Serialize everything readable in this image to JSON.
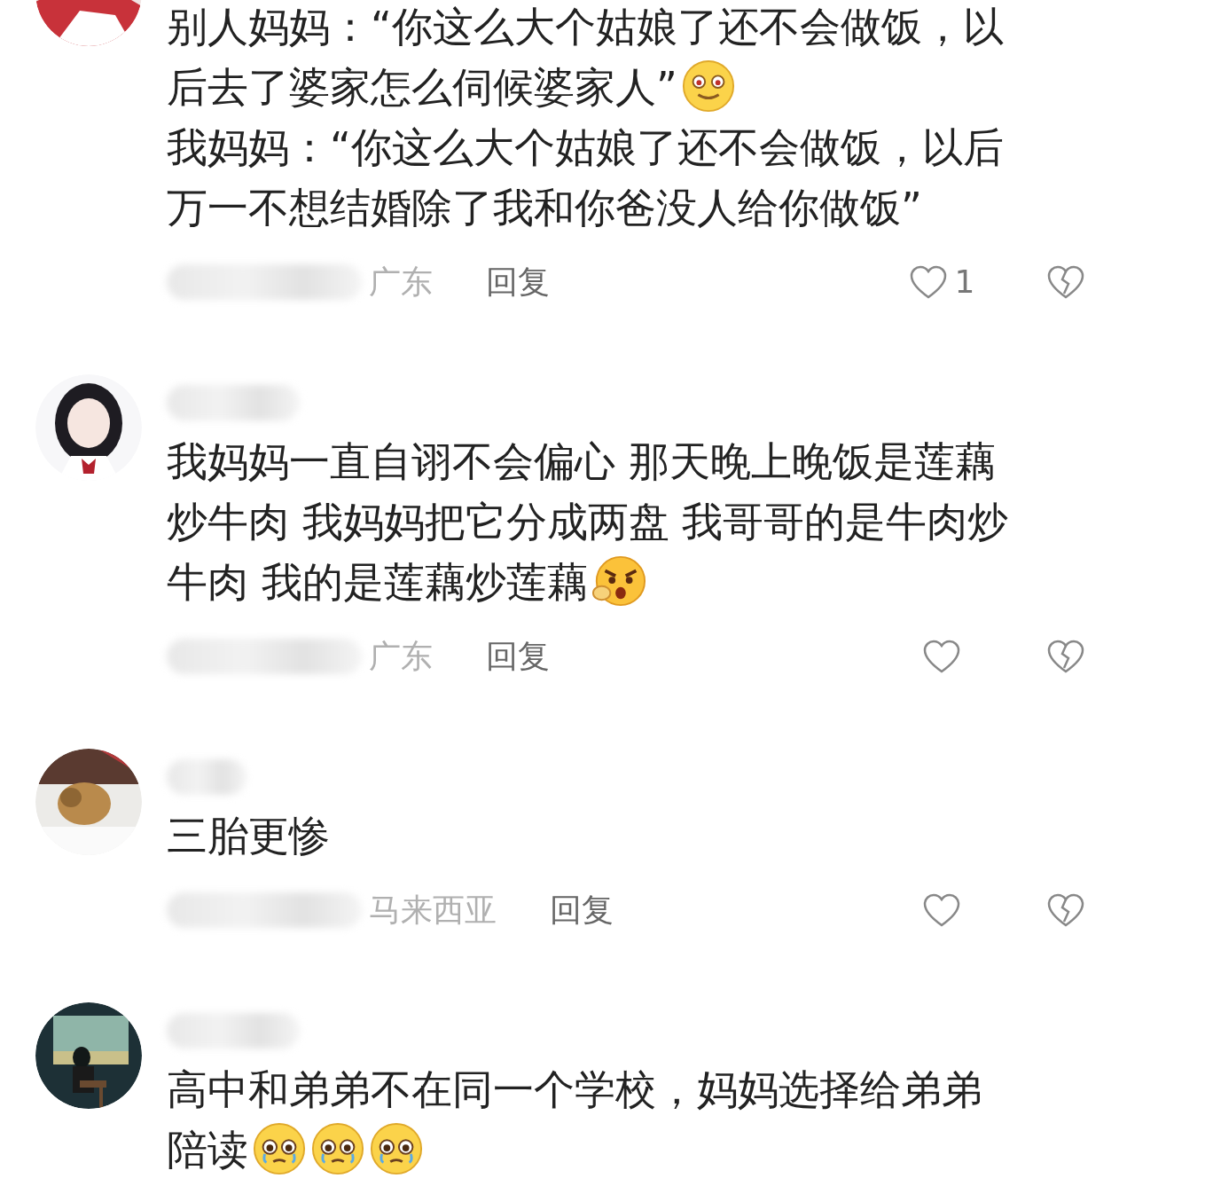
{
  "comments": [
    {
      "avatar": {
        "kind": "picture"
      },
      "lines": [
        [
          {
            "kind": "text",
            "text": "别人妈妈：“你这么大个姑娘了还不会做饭，以"
          }
        ],
        [
          {
            "kind": "text",
            "text": "后去了婆家怎么伺候婆家人”"
          },
          {
            "kind": "blush"
          }
        ],
        [
          {
            "kind": "text",
            "text": "我妈妈：“你这么大个姑娘了还不会做饭，以后"
          }
        ],
        [
          {
            "kind": "text",
            "text": "万一不想结婚除了我和你爸没人给你做饭”"
          }
        ]
      ],
      "location": "广东",
      "reply": "回复",
      "likes": "1"
    },
    {
      "avatar": {
        "kind": "picture"
      },
      "lines": [
        [
          {
            "kind": "text",
            "text": "我妈妈一直自诩不会偏心 那天晚上晚饭是莲藕"
          }
        ],
        [
          {
            "kind": "text",
            "text": "炒牛肉 我妈妈把它分成两盘 我哥哥的是牛肉炒"
          }
        ],
        [
          {
            "kind": "text",
            "text": "牛肉 我的是莲藕炒莲藕"
          },
          {
            "kind": "angry"
          }
        ]
      ],
      "location": "广东",
      "reply": "回复"
    },
    {
      "avatar": {
        "kind": "picture"
      },
      "lines": [
        [
          {
            "kind": "text",
            "text": "三胎更惨"
          }
        ]
      ],
      "location": "马来西亚",
      "reply": "回复"
    },
    {
      "avatar": {
        "kind": "picture"
      },
      "lines": [
        [
          {
            "kind": "text",
            "text": "高中和弟弟不在同一个学校，妈妈选择给弟弟"
          }
        ],
        [
          {
            "kind": "text",
            "text": "陪读"
          },
          {
            "kind": "teary"
          },
          {
            "kind": "teary"
          },
          {
            "kind": "teary"
          }
        ]
      ]
    }
  ]
}
